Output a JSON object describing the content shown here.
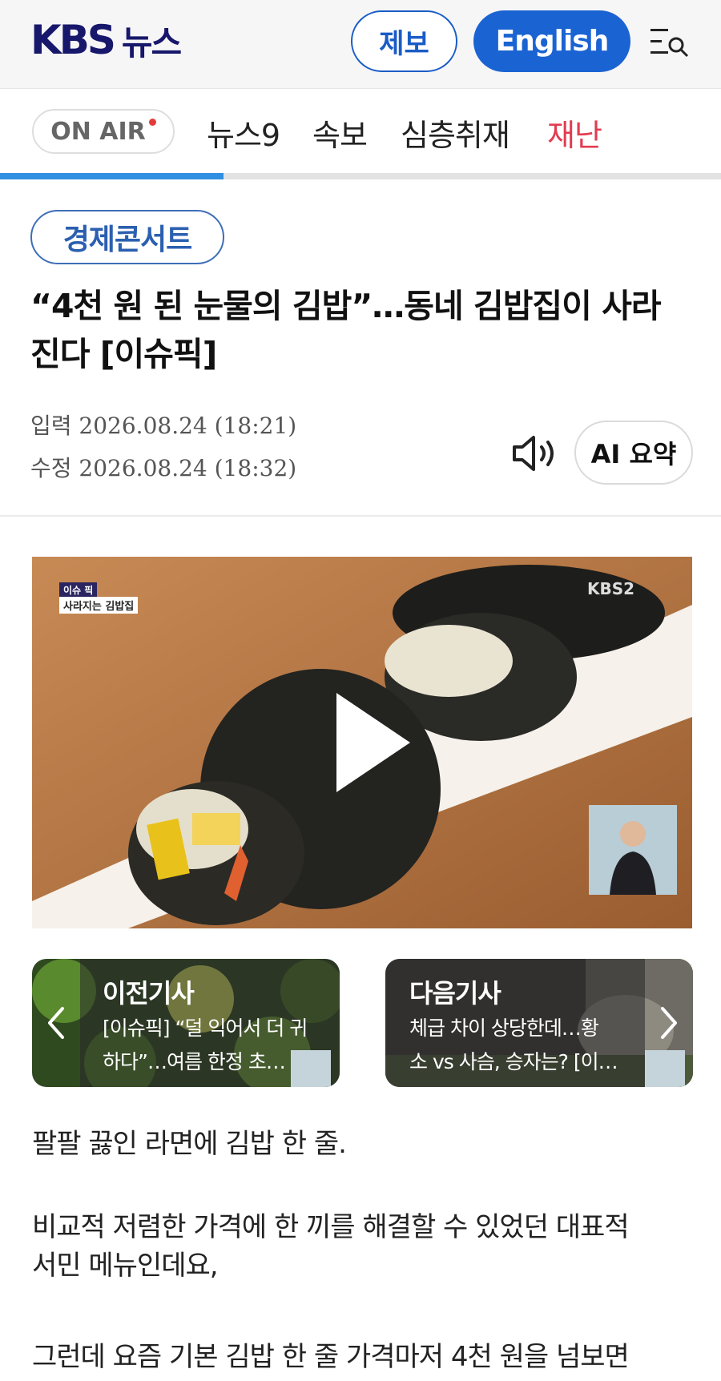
{
  "header": {
    "logo_kbs": "KBS",
    "logo_news": "뉴스",
    "report_button": "제보",
    "english_button": "English",
    "colors": {
      "brand": "#17176b",
      "accent": "#1a63d2"
    }
  },
  "nav": {
    "onair_label": "ON AIR",
    "items": [
      "뉴스9",
      "속보",
      "심층취재",
      "재난"
    ],
    "progress": 0.31
  },
  "article": {
    "category": "경제콘서트",
    "title_line1": "“4천 원 된 눈물의 김밥”…동네 김밥집이 사라",
    "title_line2": "진다 [이슈픽]",
    "input_date": "입력 2026.08.24 (18:21)",
    "modified_date": "수정 2026.08.24 (18:32)",
    "ai_summary_button": "AI 요약"
  },
  "video": {
    "badge_top": "이슈 픽",
    "badge_bottom": "사라지는 김밥집",
    "channel_logo": "KBS2"
  },
  "prev_card": {
    "heading": "이전기사",
    "line1": "[이슈픽] “덜 익어서 더 귀",
    "line2": "하다”…여름 한정 초…"
  },
  "next_card": {
    "heading": "다음기사",
    "line1": "체급 차이 상당한데…황",
    "line2": "소 vs 사슴, 승자는? [이…"
  },
  "body": {
    "p1": "팔팔 끓인 라면에 김밥 한 줄.",
    "p2_line1": "비교적 저렴한 가격에 한 끼를 해결할 수 있었던 대표적",
    "p2_line2": "서민 메뉴인데요,",
    "p3": "그런데 요즘 기본 김밥 한 줄 가격마저 4천 원을 넘보면"
  }
}
